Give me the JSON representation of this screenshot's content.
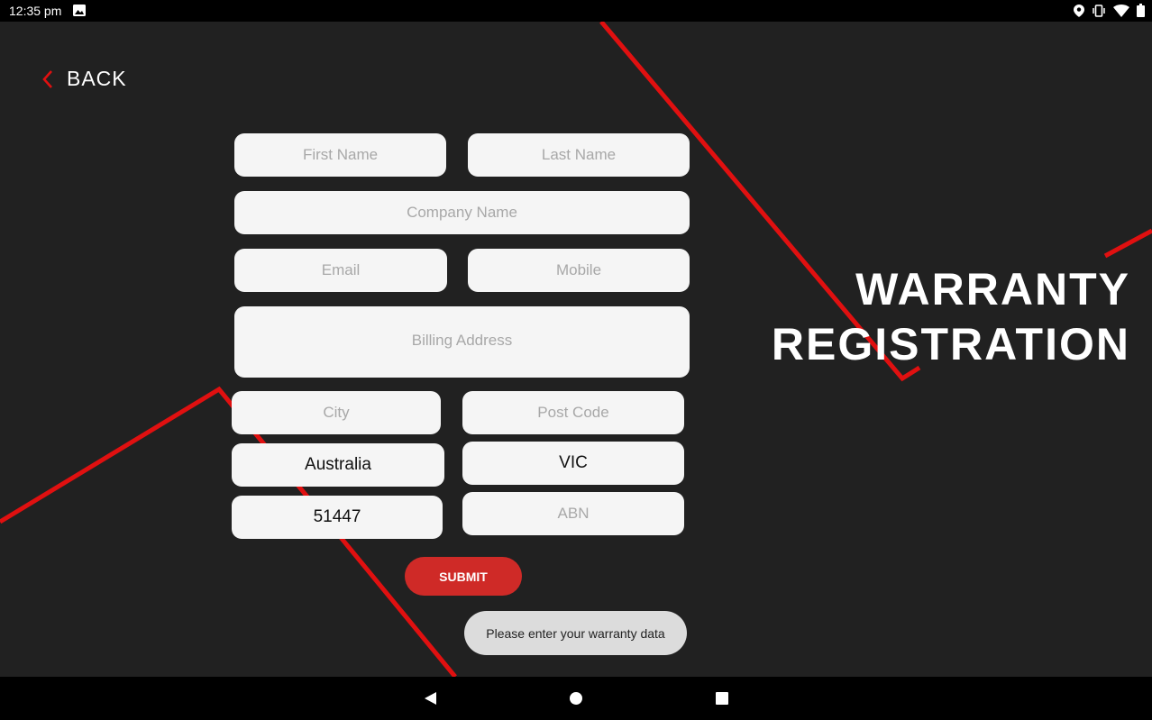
{
  "status_bar": {
    "time": "12:35 pm"
  },
  "header": {
    "back_label": "BACK"
  },
  "title": {
    "line1": "WARRANTY",
    "line2": "REGISTRATION"
  },
  "form": {
    "first_name": {
      "placeholder": "First Name",
      "value": ""
    },
    "last_name": {
      "placeholder": "Last Name",
      "value": ""
    },
    "company_name": {
      "placeholder": "Company Name",
      "value": ""
    },
    "email": {
      "placeholder": "Email",
      "value": ""
    },
    "mobile": {
      "placeholder": "Mobile",
      "value": ""
    },
    "billing_address": {
      "placeholder": "Billing Address",
      "value": ""
    },
    "city": {
      "placeholder": "City",
      "value": ""
    },
    "post_code": {
      "placeholder": "Post Code",
      "value": ""
    },
    "country": {
      "value": "Australia"
    },
    "state": {
      "value": "VIC"
    },
    "number": {
      "value": "51447"
    },
    "abn": {
      "placeholder": "ABN",
      "value": ""
    },
    "submit_label": "SUBMIT"
  },
  "toast": {
    "message": "Please enter your warranty data"
  },
  "colors": {
    "background": "#212121",
    "accent_red": "#e01010",
    "submit_red": "#cf2a27",
    "field_bg": "#f5f5f5"
  },
  "icons": {
    "status_left": "image-icon",
    "status_right": [
      "location-icon",
      "vibrate-icon",
      "wifi-icon",
      "battery-icon"
    ],
    "nav": [
      "back-triangle-icon",
      "home-circle-icon",
      "recents-square-icon"
    ]
  }
}
